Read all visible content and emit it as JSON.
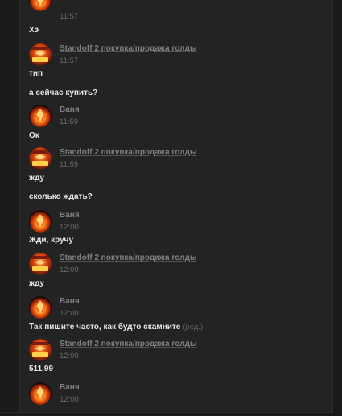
{
  "chat": {
    "partial_top": {
      "time": "11:57",
      "text": "Хэ"
    },
    "messages": [
      {
        "author": "Standoff 2 покупка/продажа голды",
        "time": "11:57",
        "lines": [
          "тип",
          "а сейчас купить?"
        ]
      },
      {
        "author": "Ваня",
        "time": "11:59",
        "lines": [
          "Ок"
        ]
      },
      {
        "author": "Standoff 2 покупка/продажа голды",
        "time": "11:59",
        "lines": [
          "жду",
          "сколько ждать?"
        ]
      },
      {
        "author": "Ваня",
        "time": "12:00",
        "lines": [
          "Жди, кручу"
        ]
      },
      {
        "author": "Standoff 2 покупка/продажа голды",
        "time": "12:00",
        "lines": [
          "жду"
        ]
      },
      {
        "author": "Ваня",
        "time": "12:00",
        "lines": [
          "Так пишите часто, как будто скамните"
        ],
        "edited_label": "(ред.)"
      },
      {
        "author": "Standoff 2 покупка/продажа голды",
        "time": "12:00",
        "lines": [
          "511.99"
        ]
      },
      {
        "author": "Ваня",
        "time": "12:00",
        "lines": []
      }
    ]
  },
  "colors": {
    "background": "#232323",
    "message_text": "#e6e6e6",
    "author_name": "#7f7f7f",
    "timestamp": "#6a6a6a"
  },
  "icons": {
    "user_avatar": "phoenix-avatar",
    "group_avatar": "shop-logo-avatar"
  }
}
